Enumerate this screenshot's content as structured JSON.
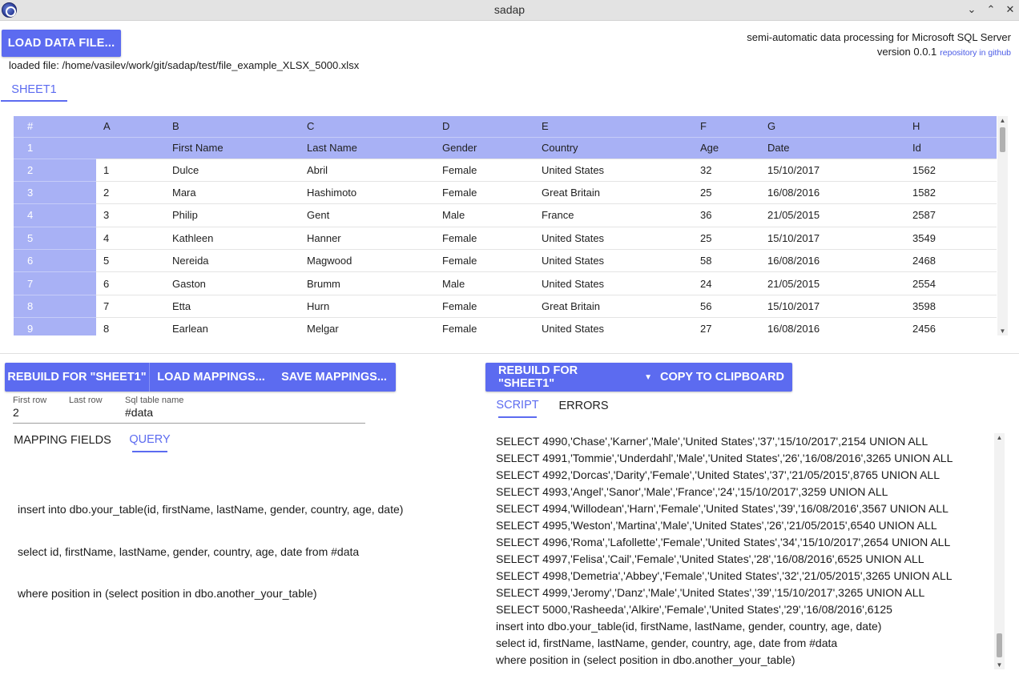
{
  "window": {
    "title": "sadap"
  },
  "header": {
    "load_button": "LOAD DATA FILE...",
    "tagline": "semi-automatic data processing for Microsoft SQL Server",
    "version": "version 0.0.1",
    "repo_link": "repository in github",
    "loaded_file": "loaded file: /home/vasilev/work/git/sadap/test/file_example_XLSX_5000.xlsx"
  },
  "sheet_tabs": [
    "SHEET1"
  ],
  "grid": {
    "columns": [
      "#",
      "A",
      "B",
      "C",
      "D",
      "E",
      "F",
      "G",
      "H"
    ],
    "field_row": [
      "1",
      "",
      "First Name",
      "Last Name",
      "Gender",
      "Country",
      "Age",
      "Date",
      "Id"
    ],
    "rows": [
      [
        "2",
        "1",
        "Dulce",
        "Abril",
        "Female",
        "United States",
        "32",
        "15/10/2017",
        "1562"
      ],
      [
        "3",
        "2",
        "Mara",
        "Hashimoto",
        "Female",
        "Great Britain",
        "25",
        "16/08/2016",
        "1582"
      ],
      [
        "4",
        "3",
        "Philip",
        "Gent",
        "Male",
        "France",
        "36",
        "21/05/2015",
        "2587"
      ],
      [
        "5",
        "4",
        "Kathleen",
        "Hanner",
        "Female",
        "United States",
        "25",
        "15/10/2017",
        "3549"
      ],
      [
        "6",
        "5",
        "Nereida",
        "Magwood",
        "Female",
        "United States",
        "58",
        "16/08/2016",
        "2468"
      ],
      [
        "7",
        "6",
        "Gaston",
        "Brumm",
        "Male",
        "United States",
        "24",
        "21/05/2015",
        "2554"
      ],
      [
        "8",
        "7",
        "Etta",
        "Hurn",
        "Female",
        "Great Britain",
        "56",
        "15/10/2017",
        "3598"
      ],
      [
        "9",
        "8",
        "Earlean",
        "Melgar",
        "Female",
        "United States",
        "27",
        "16/08/2016",
        "2456"
      ]
    ]
  },
  "left_panel": {
    "rebuild_button": "REBUILD FOR \"SHEET1\"",
    "load_mappings_button": "LOAD MAPPINGS...",
    "save_mappings_button": "SAVE MAPPINGS...",
    "first_row_label": "First row",
    "first_row_value": "2",
    "last_row_label": "Last row",
    "last_row_value": "",
    "sql_table_label": "Sql table name",
    "sql_table_value": "#data",
    "tabs": {
      "mapping_fields": "MAPPING FIELDS",
      "query": "QUERY"
    },
    "query_lines": [
      "insert into dbo.your_table(id, firstName, lastName, gender, country, age, date)",
      "select id, firstName, lastName, gender, country, age, date from #data",
      "where position in (select position in dbo.another_your_table)"
    ]
  },
  "right_panel": {
    "rebuild_button": "REBUILD FOR \"SHEET1\"",
    "copy_button": "COPY TO CLIPBOARD",
    "tabs": {
      "script": "SCRIPT",
      "errors": "ERRORS"
    },
    "script_lines": [
      "SELECT 4990,'Chase','Karner','Male','United States','37','15/10/2017',2154 UNION ALL",
      "SELECT 4991,'Tommie','Underdahl','Male','United States','26','16/08/2016',3265 UNION ALL",
      "SELECT 4992,'Dorcas','Darity','Female','United States','37','21/05/2015',8765 UNION ALL",
      "SELECT 4993,'Angel','Sanor','Male','France','24','15/10/2017',3259 UNION ALL",
      "SELECT 4994,'Willodean','Harn','Female','United States','39','16/08/2016',3567 UNION ALL",
      "SELECT 4995,'Weston','Martina','Male','United States','26','21/05/2015',6540 UNION ALL",
      "SELECT 4996,'Roma','Lafollette','Female','United States','34','15/10/2017',2654 UNION ALL",
      "SELECT 4997,'Felisa','Cail','Female','United States','28','16/08/2016',6525 UNION ALL",
      "SELECT 4998,'Demetria','Abbey','Female','United States','32','21/05/2015',3265 UNION ALL",
      "SELECT 4999,'Jeromy','Danz','Male','United States','39','15/10/2017',3265 UNION ALL",
      "SELECT 5000,'Rasheeda','Alkire','Female','United States','29','16/08/2016',6125",
      "insert into dbo.your_table(id, firstName, lastName, gender, country, age, date)",
      "select id, firstName, lastName, gender, country, age, date from #data",
      "where position in (select position in dbo.another_your_table)"
    ]
  },
  "colors": {
    "accent": "#5c6bf0",
    "header_fill": "#a8b1f5"
  }
}
